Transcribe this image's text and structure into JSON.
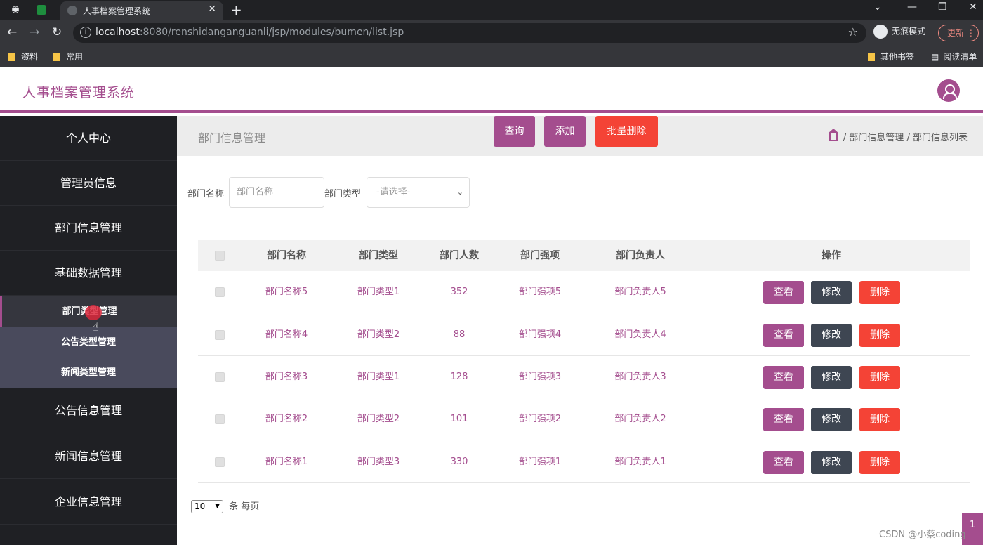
{
  "browser": {
    "tab_title": "人事档案管理系统",
    "url_host": "localhost",
    "url_rest": ":8080/renshidanganguanli/jsp/modules/bumen/list.jsp",
    "incognito_label": "无痕模式",
    "update_label": "更新",
    "bookmarks": [
      "资料",
      "常用"
    ],
    "other_bookmarks": "其他书签",
    "reading_list": "阅读清单"
  },
  "header": {
    "app_title": "人事档案管理系统"
  },
  "sidebar": {
    "items_top": [
      "个人中心",
      "管理员信息",
      "部门信息管理",
      "基础数据管理"
    ],
    "sub_items": [
      "部门类型管理",
      "公告类型管理",
      "新闻类型管理"
    ],
    "items_bottom": [
      "公告信息管理",
      "新闻信息管理",
      "企业信息管理"
    ]
  },
  "page": {
    "title": "部门信息管理",
    "breadcrumb": [
      "部门信息管理",
      "部门信息列表"
    ],
    "sep": "/"
  },
  "search": {
    "name_label": "部门名称",
    "name_placeholder": "部门名称",
    "type_label": "部门类型",
    "type_selected": "-请选择-",
    "query_label": "查询",
    "add_label": "添加",
    "batch_delete_label": "批量删除"
  },
  "table": {
    "headers": [
      "部门名称",
      "部门类型",
      "部门人数",
      "部门强项",
      "部门负责人",
      "操作"
    ],
    "rows": [
      [
        "部门名称5",
        "部门类型1",
        "352",
        "部门强项5",
        "部门负责人5"
      ],
      [
        "部门名称4",
        "部门类型2",
        "88",
        "部门强项4",
        "部门负责人4"
      ],
      [
        "部门名称3",
        "部门类型1",
        "128",
        "部门强项3",
        "部门负责人3"
      ],
      [
        "部门名称2",
        "部门类型2",
        "101",
        "部门强项2",
        "部门负责人2"
      ],
      [
        "部门名称1",
        "部门类型3",
        "330",
        "部门强项1",
        "部门负责人1"
      ]
    ],
    "action_view": "查看",
    "action_edit": "修改",
    "action_delete": "删除"
  },
  "pager": {
    "page_size": "10",
    "suffix": "条 每页",
    "current_page": "1"
  },
  "watermark": "CSDN @小蔡coding",
  "colors": {
    "accent": "#a44d8e",
    "danger": "#f44336",
    "dark_btn": "#3e4652"
  }
}
